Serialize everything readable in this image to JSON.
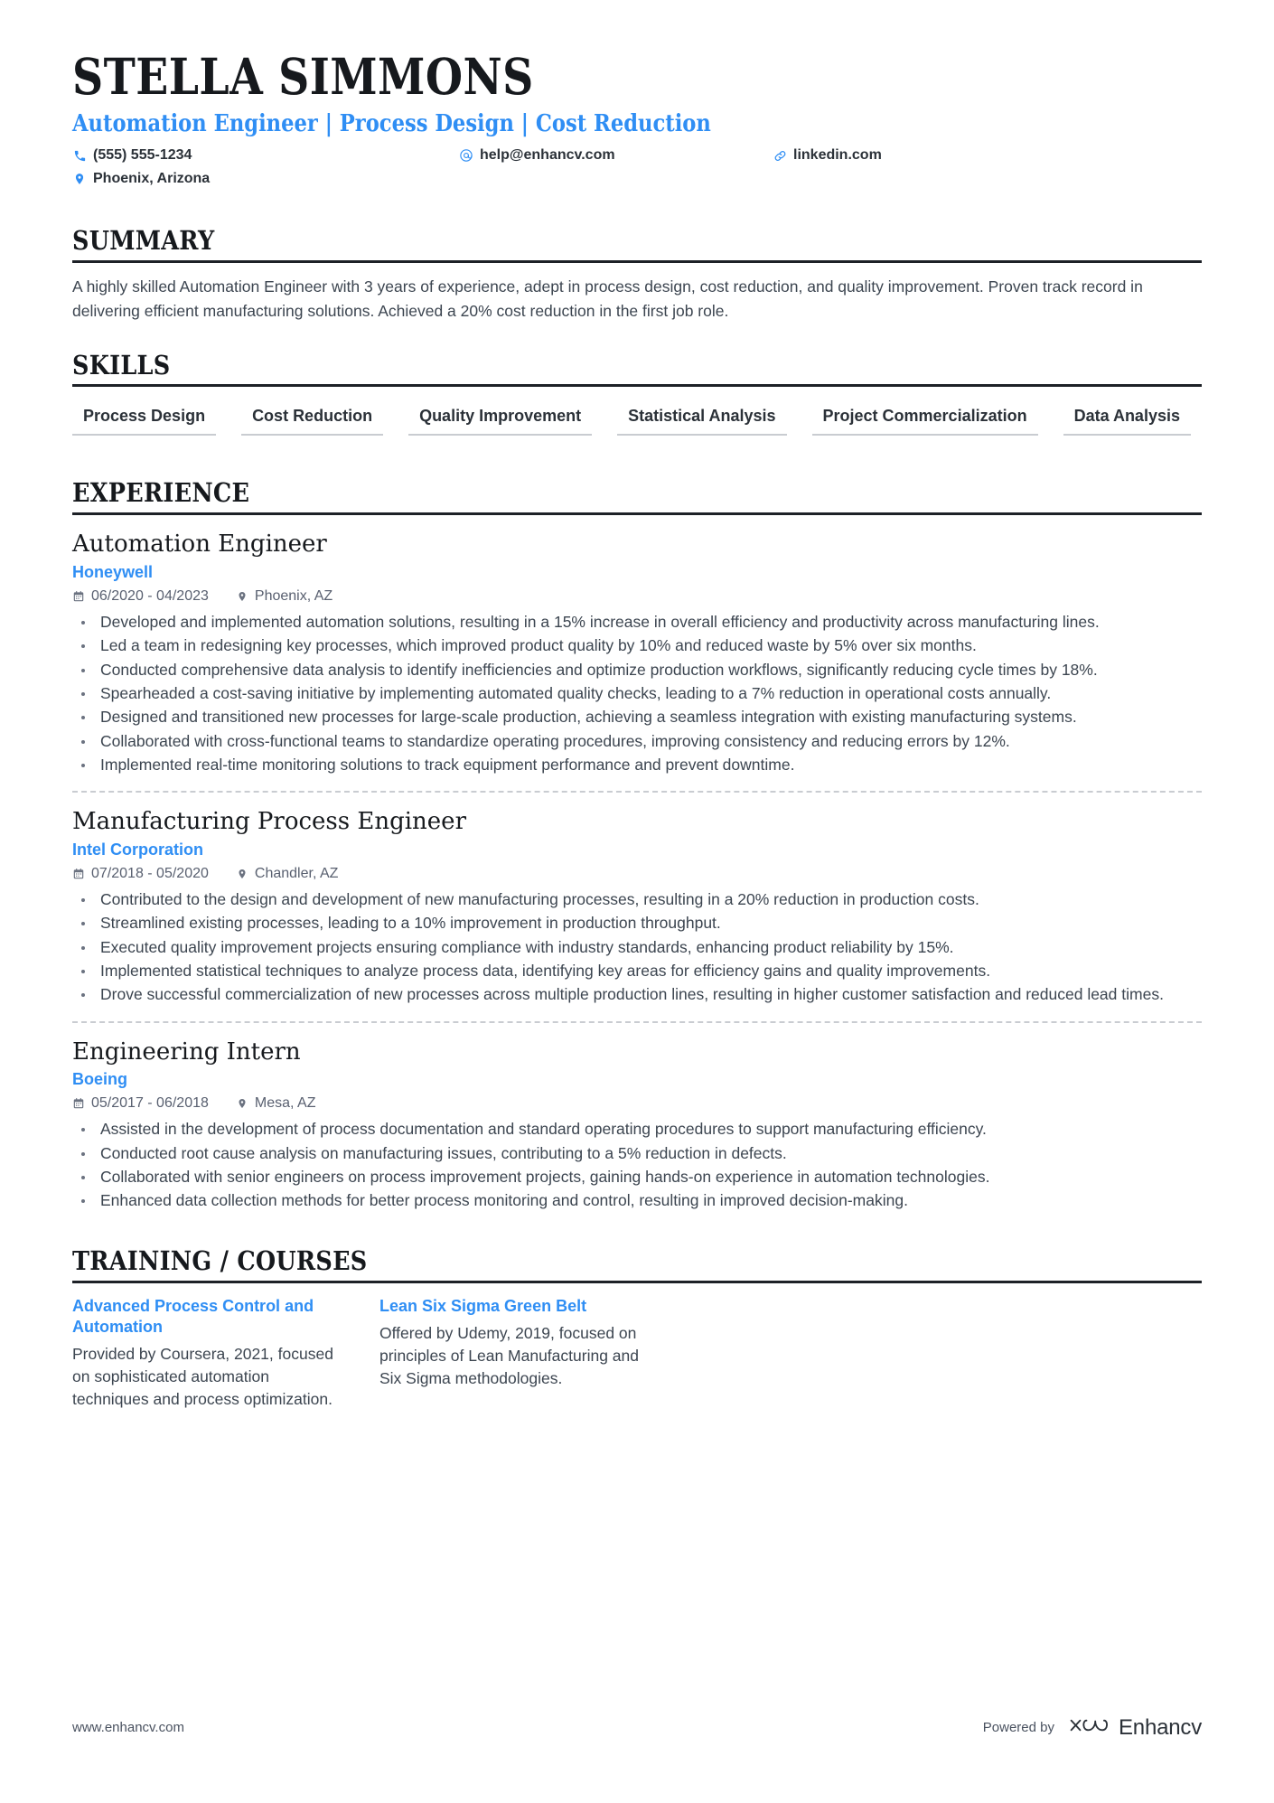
{
  "theme": {
    "accent": "#2f8ef4",
    "text": "#3c4550",
    "heading": "#16191d",
    "rule": "#1d2127",
    "muted": "#c9ccd1"
  },
  "header": {
    "name": "STELLA SIMMONS",
    "tagline": "Automation Engineer | Process Design | Cost Reduction",
    "contacts": [
      {
        "icon": "phone-icon",
        "text": "(555) 555-1234"
      },
      {
        "icon": "at-icon",
        "text": "help@enhancv.com"
      },
      {
        "icon": "link-icon",
        "text": "linkedin.com"
      },
      {
        "icon": "location-pin-icon",
        "text": "Phoenix, Arizona"
      }
    ]
  },
  "summary": {
    "title": "SUMMARY",
    "text": "A highly skilled Automation Engineer with 3 years of experience, adept in process design, cost reduction, and quality improvement. Proven track record in delivering efficient manufacturing solutions. Achieved a 20% cost reduction in the first job role."
  },
  "skills": {
    "title": "SKILLS",
    "items": [
      "Process Design",
      "Cost Reduction",
      "Quality Improvement",
      "Statistical Analysis",
      "Project Commercialization",
      "Data Analysis"
    ]
  },
  "experience": {
    "title": "EXPERIENCE",
    "jobs": [
      {
        "title": "Automation Engineer",
        "company": "Honeywell",
        "dates": "06/2020 - 04/2023",
        "location": "Phoenix, AZ",
        "bullets": [
          "Developed and implemented automation solutions, resulting in a 15% increase in overall efficiency and productivity across manufacturing lines.",
          "Led a team in redesigning key processes, which improved product quality by 10% and reduced waste by 5% over six months.",
          "Conducted comprehensive data analysis to identify inefficiencies and optimize production workflows, significantly reducing cycle times by 18%.",
          "Spearheaded a cost-saving initiative by implementing automated quality checks, leading to a 7% reduction in operational costs annually.",
          "Designed and transitioned new processes for large-scale production, achieving a seamless integration with existing manufacturing systems.",
          "Collaborated with cross-functional teams to standardize operating procedures, improving consistency and reducing errors by 12%.",
          "Implemented real-time monitoring solutions to track equipment performance and prevent downtime."
        ]
      },
      {
        "title": "Manufacturing Process Engineer",
        "company": "Intel Corporation",
        "dates": "07/2018 - 05/2020",
        "location": "Chandler, AZ",
        "bullets": [
          "Contributed to the design and development of new manufacturing processes, resulting in a 20% reduction in production costs.",
          "Streamlined existing processes, leading to a 10% improvement in production throughput.",
          "Executed quality improvement projects ensuring compliance with industry standards, enhancing product reliability by 15%.",
          "Implemented statistical techniques to analyze process data, identifying key areas for efficiency gains and quality improvements.",
          "Drove successful commercialization of new processes across multiple production lines, resulting in higher customer satisfaction and reduced lead times."
        ]
      },
      {
        "title": "Engineering Intern",
        "company": "Boeing",
        "dates": "05/2017 - 06/2018",
        "location": "Mesa, AZ",
        "bullets": [
          "Assisted in the development of process documentation and standard operating procedures to support manufacturing efficiency.",
          "Conducted root cause analysis on manufacturing issues, contributing to a 5% reduction in defects.",
          "Collaborated with senior engineers on process improvement projects, gaining hands-on experience in automation technologies.",
          "Enhanced data collection methods for better process monitoring and control, resulting in improved decision-making."
        ]
      }
    ]
  },
  "training": {
    "title": "TRAINING / COURSES",
    "items": [
      {
        "name": "Advanced Process Control and Automation",
        "description": "Provided by Coursera, 2021, focused on sophisticated automation techniques and process optimization."
      },
      {
        "name": "Lean Six Sigma Green Belt",
        "description": "Offered by Udemy, 2019, focused on principles of Lean Manufacturing and Six Sigma methodologies."
      }
    ]
  },
  "footer": {
    "url": "www.enhancv.com",
    "powered_by": "Powered by",
    "brand": "Enhancv"
  }
}
